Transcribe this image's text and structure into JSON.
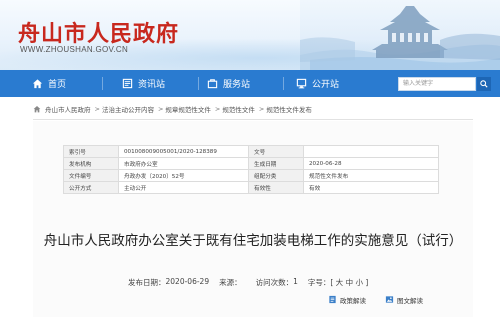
{
  "site": {
    "title": "舟山市人民政府",
    "url": "WWW.ZHOUSHAN.GOV.CN"
  },
  "nav": {
    "items": [
      {
        "label": "首页",
        "icon": "home-icon"
      },
      {
        "label": "资讯站",
        "icon": "news-icon"
      },
      {
        "label": "服务站",
        "icon": "service-icon"
      },
      {
        "label": "公开站",
        "icon": "disclosure-icon"
      }
    ],
    "search_placeholder": "输入关键字"
  },
  "breadcrumb": [
    "舟山市人民政府",
    "法治主动公开内容",
    "规章规范性文件",
    "规范性文件",
    "规范性文件发布"
  ],
  "meta_table": {
    "rows": [
      {
        "k1": "索引号",
        "v1": "001008009005001/2020-128389",
        "k2": "文号",
        "v2": ""
      },
      {
        "k1": "发布机构",
        "v1": "市政府办公室",
        "k2": "生成日期",
        "v2": "2020-06-28"
      },
      {
        "k1": "文件编号",
        "v1": "舟政办发〔2020〕52号",
        "k2": "组配分类",
        "v2": "规范性文件发布"
      },
      {
        "k1": "公开方式",
        "v1": "主动公开",
        "k2": "有效性",
        "v2": "有效"
      }
    ]
  },
  "article": {
    "title": "舟山市人民政府办公室关于既有住宅加装电梯工作的实施意见（试行）",
    "pub_date_label": "发布日期：",
    "pub_date": "2020-06-29",
    "source_label": "来源：",
    "source": "",
    "visits_label": "访问次数：",
    "visits": "1",
    "font_label": "字号：",
    "font_sizes": "[ 大 中 小 ]"
  },
  "actions": {
    "share": "政策解读",
    "print": "图文解读"
  },
  "colors": {
    "brand_red": "#c8281e",
    "nav_blue": "#2a7bd0"
  }
}
